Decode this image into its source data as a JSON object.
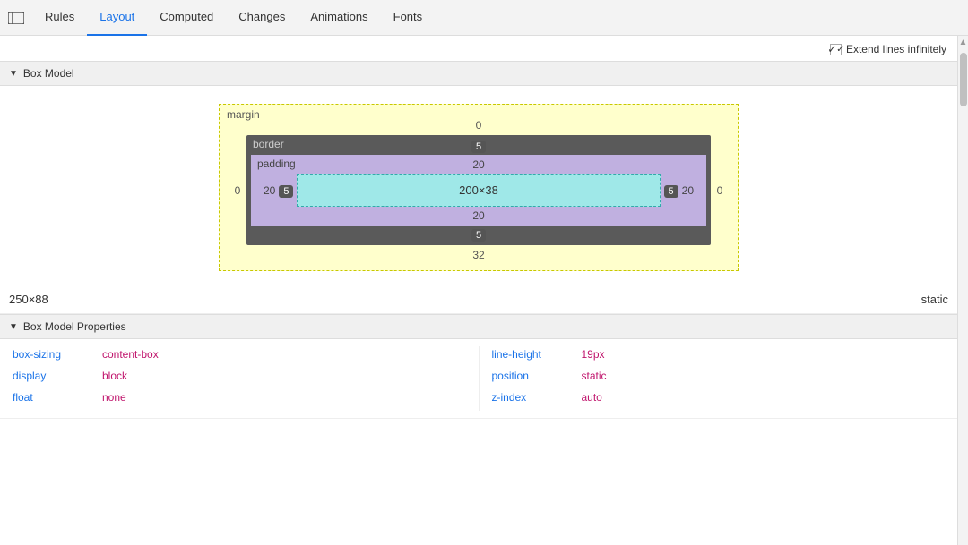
{
  "tabs": [
    {
      "id": "rules",
      "label": "Rules",
      "active": false
    },
    {
      "id": "layout",
      "label": "Layout",
      "active": true
    },
    {
      "id": "computed",
      "label": "Computed",
      "active": false
    },
    {
      "id": "changes",
      "label": "Changes",
      "active": false
    },
    {
      "id": "animations",
      "label": "Animations",
      "active": false
    },
    {
      "id": "fonts",
      "label": "Fonts",
      "active": false
    }
  ],
  "toolbar": {
    "extend_lines_label": "Extend lines infinitely",
    "extend_lines_checked": true
  },
  "box_model_section": {
    "label": "Box Model",
    "margin": {
      "label": "margin",
      "top": "0",
      "right": "0",
      "bottom": "32",
      "left": "0"
    },
    "border": {
      "label": "border",
      "top": "5",
      "right": "5",
      "bottom": "5",
      "left": "5"
    },
    "padding": {
      "label": "padding",
      "top": "20",
      "right": "20",
      "bottom": "20",
      "left": "20"
    },
    "content": {
      "width": "200",
      "height": "38",
      "label": "200×38"
    }
  },
  "dimensions": {
    "size": "250×88",
    "position": "static"
  },
  "box_model_properties_section": {
    "label": "Box Model Properties"
  },
  "properties_left": [
    {
      "name": "box-sizing",
      "value": "content-box"
    },
    {
      "name": "display",
      "value": "block"
    },
    {
      "name": "float",
      "value": "none"
    }
  ],
  "properties_right": [
    {
      "name": "line-height",
      "value": "19px"
    },
    {
      "name": "position",
      "value": "static"
    },
    {
      "name": "z-index",
      "value": "auto"
    }
  ],
  "icons": {
    "panel_toggle": "⊞",
    "arrow_down": "▼",
    "checkmark": "✓"
  }
}
